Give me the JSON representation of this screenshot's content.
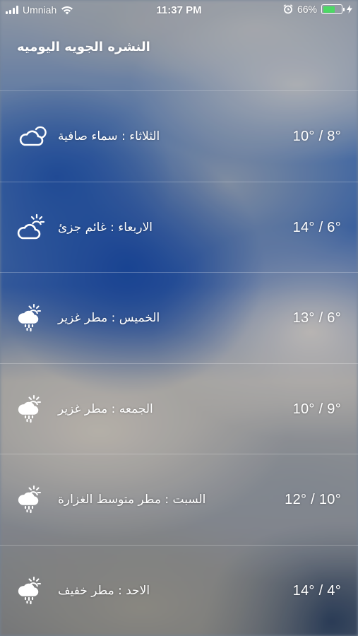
{
  "status_bar": {
    "carrier": "Umniah",
    "time": "11:37 PM",
    "battery_percent": "66%",
    "battery_level": 0.66,
    "icons": [
      "signal-icon",
      "wifi-icon",
      "alarm-icon",
      "battery-icon",
      "charging-bolt-icon"
    ],
    "battery_color": "#4cd964"
  },
  "header": {
    "title": "النشره الجويه اليوميه"
  },
  "forecast": [
    {
      "desc": "الثلاثاء : سماء صافية",
      "temp": "10° / 8°",
      "icon": "cloud-moon-icon"
    },
    {
      "desc": "الاربعاء : غائم جزئ",
      "temp": "14° / 6°",
      "icon": "partly-cloudy-icon"
    },
    {
      "desc": "الخميس : مطر غزير",
      "temp": "13° / 6°",
      "icon": "rain-sun-icon"
    },
    {
      "desc": "الجمعه : مطر غزير",
      "temp": "10° / 9°",
      "icon": "rain-sun-icon"
    },
    {
      "desc": "السبت : مطر متوسط الغزارة",
      "temp": "12° / 10°",
      "icon": "rain-sun-icon"
    },
    {
      "desc": "الاحد : مطر خفيف",
      "temp": "14° / 4°",
      "icon": "rain-sun-icon"
    }
  ]
}
